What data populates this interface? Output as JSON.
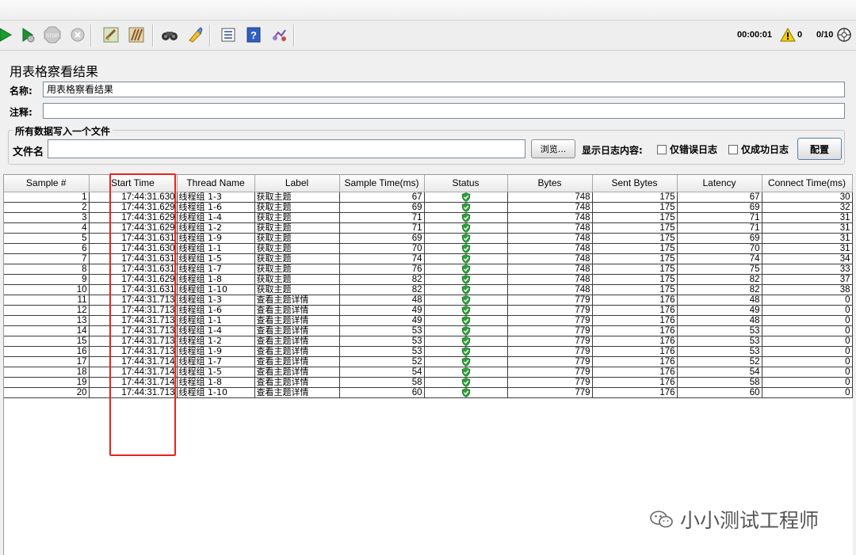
{
  "toolbar": {
    "icons": [
      "start-icon",
      "start-no-pause-icon",
      "stop-icon",
      "shutdown-icon",
      "clear-icon",
      "clear-all-icon",
      "search-icon",
      "reset-search-icon",
      "function-helper-icon",
      "help-icon",
      "remote-icon"
    ],
    "timer": "00:00:01",
    "error_count": "0",
    "threads": "0/10"
  },
  "panel": {
    "title": "用表格察看结果",
    "name_label": "名称:",
    "name_value": "用表格察看结果",
    "comment_label": "注释:",
    "comment_value": "",
    "file_group_title": "所有数据写入一个文件",
    "file_label": "文件名",
    "file_value": "",
    "browse_label": "浏览...",
    "log_content_label": "显示日志内容:",
    "errors_only_label": "仅错误日志",
    "success_only_label": "仅成功日志",
    "configure_label": "配置"
  },
  "table": {
    "columns": [
      "Sample #",
      "Start Time",
      "Thread Name",
      "Label",
      "Sample Time(ms)",
      "Status",
      "Bytes",
      "Sent Bytes",
      "Latency",
      "Connect Time(ms)"
    ],
    "rows": [
      [
        "1",
        "17:44:31.630",
        "线程组 1-3",
        "获取主题",
        "67",
        "success",
        "748",
        "175",
        "67",
        "30"
      ],
      [
        "2",
        "17:44:31.629",
        "线程组 1-6",
        "获取主题",
        "69",
        "success",
        "748",
        "175",
        "69",
        "32"
      ],
      [
        "3",
        "17:44:31.629",
        "线程组 1-4",
        "获取主题",
        "71",
        "success",
        "748",
        "175",
        "71",
        "31"
      ],
      [
        "4",
        "17:44:31.629",
        "线程组 1-2",
        "获取主题",
        "71",
        "success",
        "748",
        "175",
        "71",
        "31"
      ],
      [
        "5",
        "17:44:31.631",
        "线程组 1-9",
        "获取主题",
        "69",
        "success",
        "748",
        "175",
        "69",
        "31"
      ],
      [
        "6",
        "17:44:31.630",
        "线程组 1-1",
        "获取主题",
        "70",
        "success",
        "748",
        "175",
        "70",
        "31"
      ],
      [
        "7",
        "17:44:31.631",
        "线程组 1-5",
        "获取主题",
        "74",
        "success",
        "748",
        "175",
        "74",
        "34"
      ],
      [
        "8",
        "17:44:31.631",
        "线程组 1-7",
        "获取主题",
        "76",
        "success",
        "748",
        "175",
        "75",
        "33"
      ],
      [
        "9",
        "17:44:31.629",
        "线程组 1-8",
        "获取主题",
        "82",
        "success",
        "748",
        "175",
        "82",
        "37"
      ],
      [
        "10",
        "17:44:31.631",
        "线程组 1-10",
        "获取主题",
        "82",
        "success",
        "748",
        "175",
        "82",
        "38"
      ],
      [
        "11",
        "17:44:31.713",
        "线程组 1-3",
        "查看主题详情",
        "48",
        "success",
        "779",
        "176",
        "48",
        "0"
      ],
      [
        "12",
        "17:44:31.713",
        "线程组 1-6",
        "查看主题详情",
        "49",
        "success",
        "779",
        "176",
        "49",
        "0"
      ],
      [
        "13",
        "17:44:31.713",
        "线程组 1-1",
        "查看主题详情",
        "49",
        "success",
        "779",
        "176",
        "48",
        "0"
      ],
      [
        "14",
        "17:44:31.713",
        "线程组 1-4",
        "查看主题详情",
        "53",
        "success",
        "779",
        "176",
        "53",
        "0"
      ],
      [
        "15",
        "17:44:31.713",
        "线程组 1-2",
        "查看主题详情",
        "53",
        "success",
        "779",
        "176",
        "53",
        "0"
      ],
      [
        "16",
        "17:44:31.713",
        "线程组 1-9",
        "查看主题详情",
        "53",
        "success",
        "779",
        "176",
        "53",
        "0"
      ],
      [
        "17",
        "17:44:31.714",
        "线程组 1-7",
        "查看主题详情",
        "52",
        "success",
        "779",
        "176",
        "52",
        "0"
      ],
      [
        "18",
        "17:44:31.714",
        "线程组 1-5",
        "查看主题详情",
        "54",
        "success",
        "779",
        "176",
        "54",
        "0"
      ],
      [
        "19",
        "17:44:31.714",
        "线程组 1-8",
        "查看主题详情",
        "58",
        "success",
        "779",
        "176",
        "58",
        "0"
      ],
      [
        "20",
        "17:44:31.713",
        "线程组 1-10",
        "查看主题详情",
        "60",
        "success",
        "779",
        "176",
        "60",
        "0"
      ]
    ]
  },
  "colors": {
    "highlight": "#e8231f",
    "status_ok": "#2f9e3a"
  },
  "watermark": "小小测试工程师"
}
